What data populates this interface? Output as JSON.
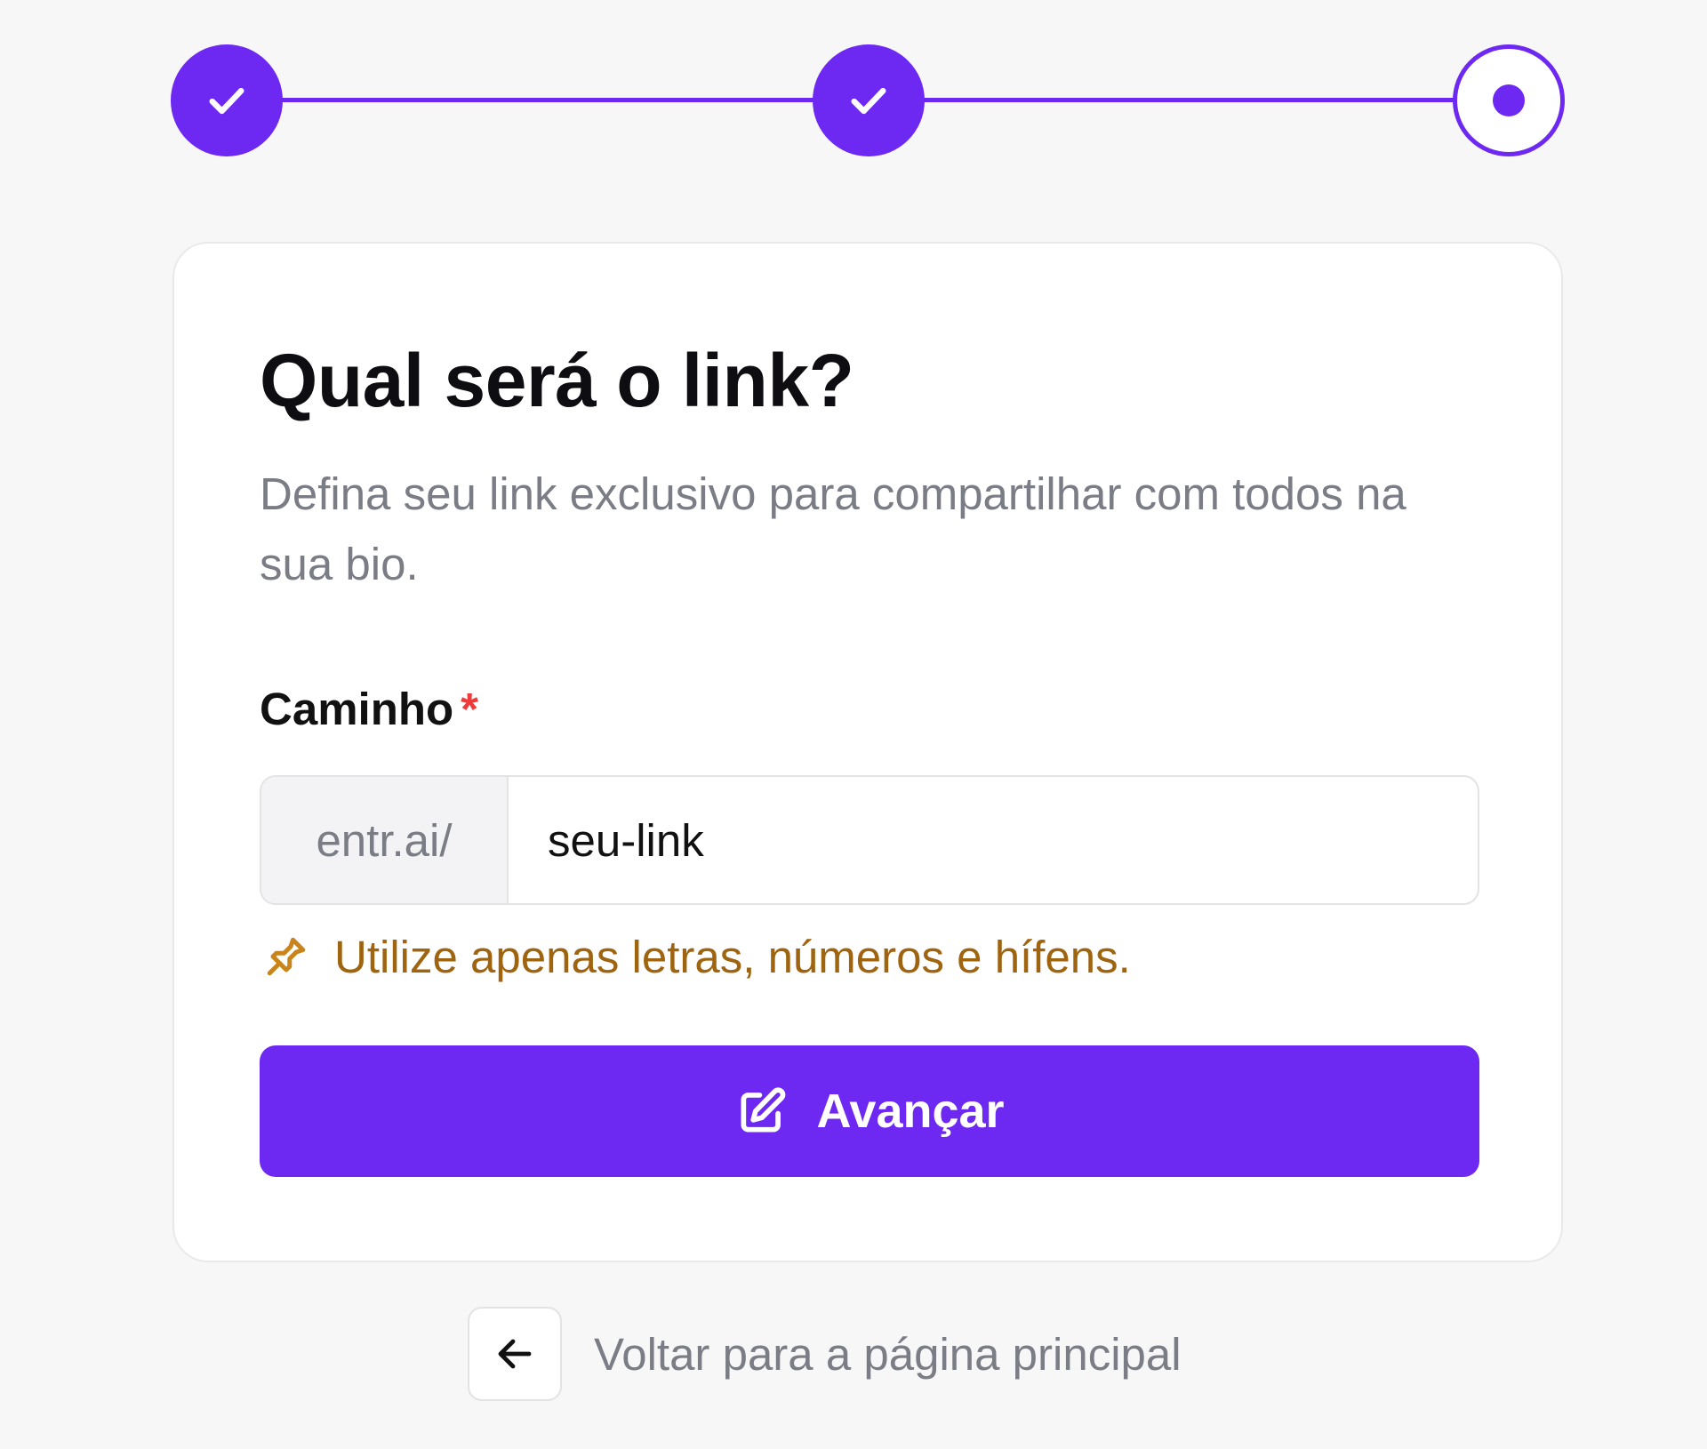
{
  "stepper": {
    "steps": [
      {
        "state": "completed",
        "icon": "check-icon"
      },
      {
        "state": "completed",
        "icon": "check-icon"
      },
      {
        "state": "current",
        "icon": "dot-icon"
      }
    ],
    "current_step": 3,
    "total_steps": 3
  },
  "card": {
    "title": "Qual será o link?",
    "subtitle": "Defina seu link exclusivo para compartilhar com todos na sua bio.",
    "field": {
      "label": "Caminho",
      "required_mark": "*",
      "prefix": "entr.ai/",
      "value": "seu-link"
    },
    "hint": {
      "icon": "pin-icon",
      "text": "Utilize apenas letras, números e hífens."
    },
    "submit": {
      "icon": "edit-icon",
      "label": "Avançar"
    }
  },
  "back": {
    "icon": "arrow-left-icon",
    "label": "Voltar para a página principal"
  },
  "colors": {
    "accent": "#6d28f2",
    "background": "#f7f7f7",
    "hint": "#9f6410",
    "required": "#ef3b3b",
    "muted_text": "#7b7d86"
  }
}
